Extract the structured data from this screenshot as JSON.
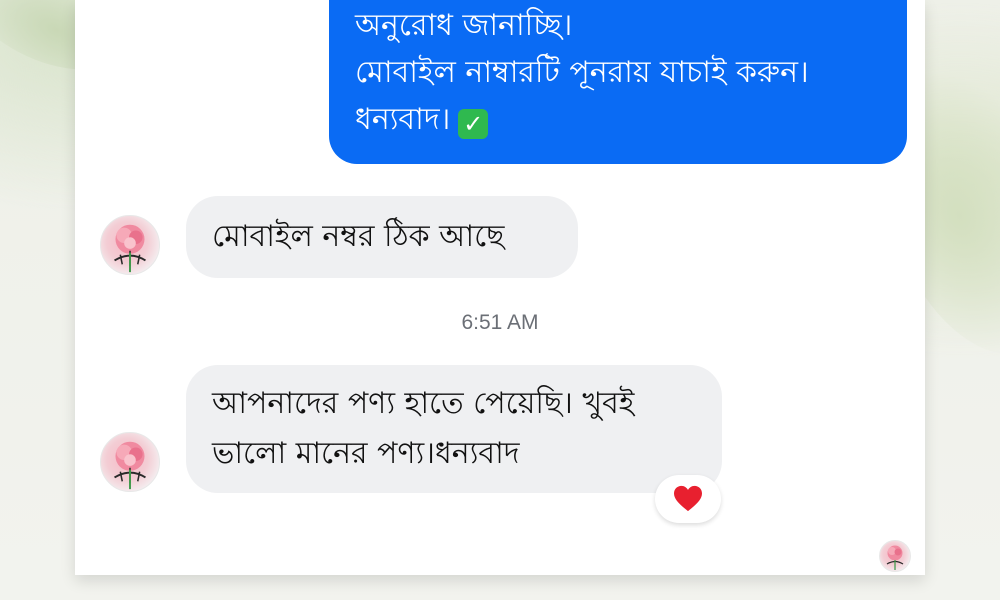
{
  "messages": {
    "outgoing": {
      "lines": [
        "অনুরোধ জানাচ্ছি।",
        "মোবাইল নাম্বারটি পূনরায় যাচাই করুন।",
        "ধন্যবাদ।"
      ],
      "emoji": "✓"
    },
    "incoming_1": {
      "text": "মোবাইল নম্বর ঠিক আছে"
    },
    "timestamp": "6:51 AM",
    "incoming_2": {
      "lines": [
        "আপনাদের পণ্য হাতে পেয়েছি। খুবই",
        "ভালো মানের পণ্য।ধন্যবাদ"
      ],
      "reaction": "heart"
    }
  },
  "colors": {
    "outgoing_bubble": "#0a6bf4",
    "incoming_bubble": "#eff0f2",
    "timestamp_text": "#6b6f76",
    "reaction_heart": "#e8202f"
  },
  "icons": {
    "avatar": "profile-avatar-rose",
    "check": "check-mark-button-emoji",
    "reaction": "red-heart-icon"
  }
}
